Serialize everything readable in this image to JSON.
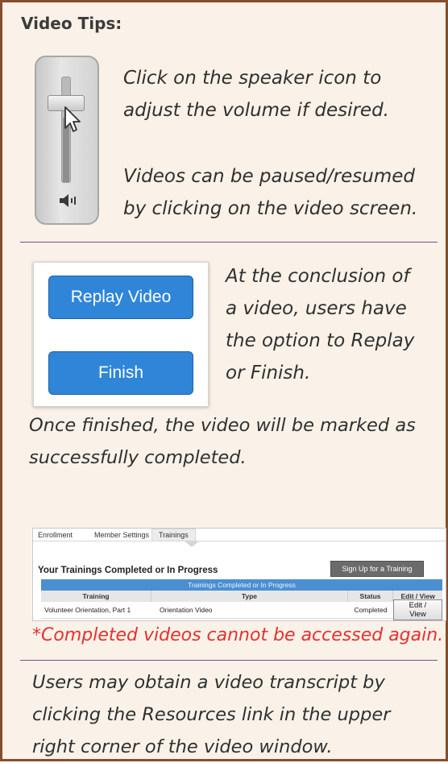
{
  "title": "Video Tips:",
  "volume_tip": {
    "line1": "Click on the speaker icon to",
    "line2": "adjust the volume if desired.",
    "line3": "Videos can be paused/resumed",
    "line4": "by clicking on the video screen."
  },
  "buttons_panel": {
    "replay_label": "Replay Video",
    "finish_label": "Finish"
  },
  "conclusion_tip": {
    "line1": "At the conclusion of",
    "line2": "a video, users have",
    "line3": "the option to Replay",
    "line4": "or Finish."
  },
  "finished_tip": {
    "line1": "Once finished, the video will be marked as",
    "line2": "successfully completed."
  },
  "trainings_screen": {
    "tabs": [
      "Enrollment",
      "Member Settings",
      "Trainings"
    ],
    "heading": "Your Trainings Completed or In Progress",
    "signup_button": "Sign Up for a Training",
    "table_title": "Trainings Completed or In Progress",
    "columns": [
      "Training",
      "Type",
      "Status",
      "Edit / View"
    ],
    "rows": [
      {
        "training": "Volunteer Orientation, Part 1",
        "type": "Orientation Video",
        "status": "Completed",
        "action": "Edit / View"
      }
    ]
  },
  "warning": "*Completed videos cannot be accessed again.",
  "transcript_tip": {
    "line1": "Users may obtain a video transcript by",
    "line2": "clicking the Resources link in the upper",
    "line3": "right corner of the video window."
  },
  "colors": {
    "frame_border": "#8a4b2f",
    "panel_bg": "#faf2e8",
    "divider": "#7b4b8a",
    "button_blue": "#2f86d9",
    "warning_red": "#e53030"
  },
  "icons": [
    "volume-slider-image",
    "mouse-cursor-icon",
    "speaker-icon"
  ]
}
